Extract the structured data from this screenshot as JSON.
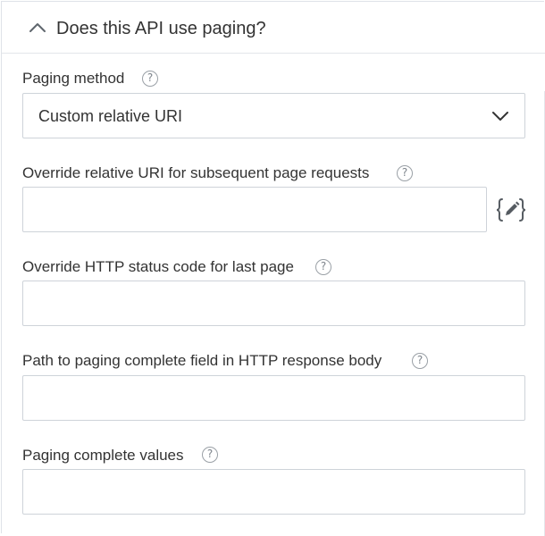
{
  "section": {
    "title": "Does this API use paging?",
    "collapse_icon": "chevron-up-icon"
  },
  "fields": {
    "paging_method": {
      "label": "Paging method",
      "selected_value": "Custom relative URI",
      "dropdown_icon": "chevron-down-icon"
    },
    "override_relative_uri": {
      "label": "Override relative URI for subsequent page requests",
      "value": "",
      "editor_icon": "script-editor-icon"
    },
    "override_http_status": {
      "label": "Override HTTP status code for last page",
      "value": ""
    },
    "paging_complete_path": {
      "label": "Path to paging complete field in HTTP response body",
      "value": ""
    },
    "paging_complete_values": {
      "label": "Paging complete values",
      "value": ""
    }
  },
  "help": {
    "glyph": "?",
    "icon": "help-icon"
  },
  "colors": {
    "border": "#ced3d9",
    "text": "#333333",
    "icon": "#7d848b"
  }
}
